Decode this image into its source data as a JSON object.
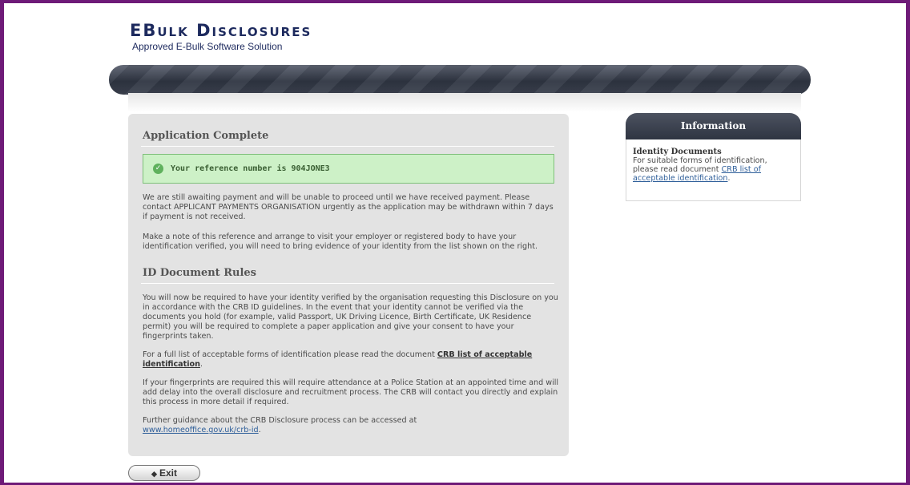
{
  "header": {
    "logo_e": "E",
    "logo_bulk_b": "B",
    "logo_bulk_rest": "ULK",
    "logo_disc_d": "D",
    "logo_disc_rest": "ISCLOSURES",
    "subtitle": "Approved E-Bulk Software Solution"
  },
  "main": {
    "heading_complete": "Application Complete",
    "reference_text": "Your reference number is 904JONE3",
    "payment_para": "We are still awaiting payment and will be unable to proceed until we have received payment. Please contact APPLICANT PAYMENTS ORGANISATION urgently as the application may be withdrawn within 7 days if payment is not received.",
    "note_para": "Make a note of this reference and arrange to visit your employer or registered body to have your identification verified, you will need to bring evidence of your identity from the list shown on the right.",
    "heading_rules": "ID Document Rules",
    "rules_para": "You will now be required to have your identity verified by the organisation requesting this Disclosure on you in accordance with the CRB ID guidelines. In the event that your identity cannot be verified via the documents you hold (for example, valid Passport, UK Driving Licence, Birth Certificate, UK Residence permit) you will be required to complete a paper application and give your consent to have your fingerprints taken.",
    "fulllist_prefix": "For a full list of acceptable forms of identification please read the document ",
    "fulllist_link": "CRB list of acceptable identification",
    "fulllist_suffix": ".",
    "fingerprint_para": "If your fingerprints are required this will require attendance at a Police Station at an appointed time and will add delay into the overall disclosure and recruitment process. The CRB will contact you directly and explain this process in more detail if required.",
    "guidance_prefix": "Further guidance about the CRB Disclosure process can be accessed at",
    "guidance_link": "www.homeoffice.gov.uk/crb-id",
    "guidance_suffix": "."
  },
  "info": {
    "header": "Information",
    "title": "Identity Documents",
    "text_prefix": "For suitable forms of identification, please read document ",
    "link": "CRB list of acceptable identification",
    "text_suffix": "."
  },
  "buttons": {
    "exit_label": "Exit"
  },
  "icons": {
    "success": "check-circle-icon",
    "exit": "back-arrow-icon"
  },
  "colors": {
    "frame": "#6e1a78",
    "brand": "#1d2a5e",
    "success_bg": "#cdf1c7",
    "link": "#2f5f9a"
  }
}
